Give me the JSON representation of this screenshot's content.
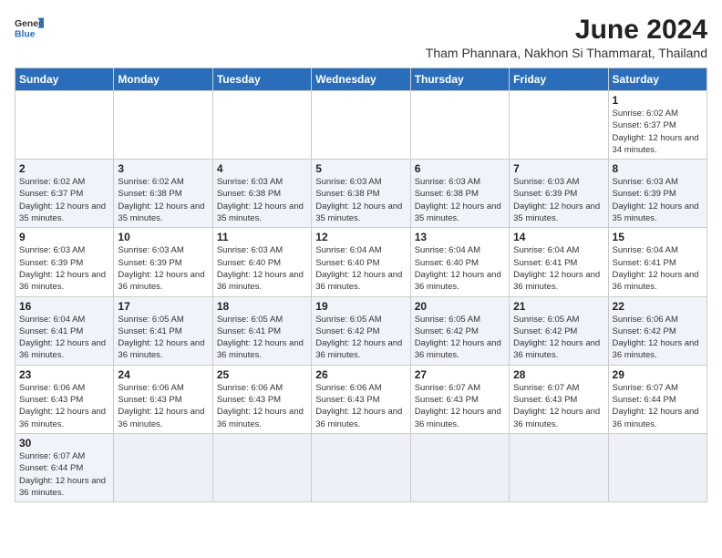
{
  "logo": {
    "text_general": "General",
    "text_blue": "Blue"
  },
  "title": "June 2024",
  "subtitle": "Tham Phannara, Nakhon Si Thammarat, Thailand",
  "days_of_week": [
    "Sunday",
    "Monday",
    "Tuesday",
    "Wednesday",
    "Thursday",
    "Friday",
    "Saturday"
  ],
  "weeks": [
    [
      {
        "day": "",
        "info": ""
      },
      {
        "day": "",
        "info": ""
      },
      {
        "day": "",
        "info": ""
      },
      {
        "day": "",
        "info": ""
      },
      {
        "day": "",
        "info": ""
      },
      {
        "day": "",
        "info": ""
      },
      {
        "day": "1",
        "info": "Sunrise: 6:02 AM\nSunset: 6:37 PM\nDaylight: 12 hours and 34 minutes."
      }
    ],
    [
      {
        "day": "2",
        "info": "Sunrise: 6:02 AM\nSunset: 6:37 PM\nDaylight: 12 hours and 35 minutes."
      },
      {
        "day": "3",
        "info": "Sunrise: 6:02 AM\nSunset: 6:38 PM\nDaylight: 12 hours and 35 minutes."
      },
      {
        "day": "4",
        "info": "Sunrise: 6:03 AM\nSunset: 6:38 PM\nDaylight: 12 hours and 35 minutes."
      },
      {
        "day": "5",
        "info": "Sunrise: 6:03 AM\nSunset: 6:38 PM\nDaylight: 12 hours and 35 minutes."
      },
      {
        "day": "6",
        "info": "Sunrise: 6:03 AM\nSunset: 6:38 PM\nDaylight: 12 hours and 35 minutes."
      },
      {
        "day": "7",
        "info": "Sunrise: 6:03 AM\nSunset: 6:39 PM\nDaylight: 12 hours and 35 minutes."
      },
      {
        "day": "8",
        "info": "Sunrise: 6:03 AM\nSunset: 6:39 PM\nDaylight: 12 hours and 35 minutes."
      }
    ],
    [
      {
        "day": "9",
        "info": "Sunrise: 6:03 AM\nSunset: 6:39 PM\nDaylight: 12 hours and 36 minutes."
      },
      {
        "day": "10",
        "info": "Sunrise: 6:03 AM\nSunset: 6:39 PM\nDaylight: 12 hours and 36 minutes."
      },
      {
        "day": "11",
        "info": "Sunrise: 6:03 AM\nSunset: 6:40 PM\nDaylight: 12 hours and 36 minutes."
      },
      {
        "day": "12",
        "info": "Sunrise: 6:04 AM\nSunset: 6:40 PM\nDaylight: 12 hours and 36 minutes."
      },
      {
        "day": "13",
        "info": "Sunrise: 6:04 AM\nSunset: 6:40 PM\nDaylight: 12 hours and 36 minutes."
      },
      {
        "day": "14",
        "info": "Sunrise: 6:04 AM\nSunset: 6:41 PM\nDaylight: 12 hours and 36 minutes."
      },
      {
        "day": "15",
        "info": "Sunrise: 6:04 AM\nSunset: 6:41 PM\nDaylight: 12 hours and 36 minutes."
      }
    ],
    [
      {
        "day": "16",
        "info": "Sunrise: 6:04 AM\nSunset: 6:41 PM\nDaylight: 12 hours and 36 minutes."
      },
      {
        "day": "17",
        "info": "Sunrise: 6:05 AM\nSunset: 6:41 PM\nDaylight: 12 hours and 36 minutes."
      },
      {
        "day": "18",
        "info": "Sunrise: 6:05 AM\nSunset: 6:41 PM\nDaylight: 12 hours and 36 minutes."
      },
      {
        "day": "19",
        "info": "Sunrise: 6:05 AM\nSunset: 6:42 PM\nDaylight: 12 hours and 36 minutes."
      },
      {
        "day": "20",
        "info": "Sunrise: 6:05 AM\nSunset: 6:42 PM\nDaylight: 12 hours and 36 minutes."
      },
      {
        "day": "21",
        "info": "Sunrise: 6:05 AM\nSunset: 6:42 PM\nDaylight: 12 hours and 36 minutes."
      },
      {
        "day": "22",
        "info": "Sunrise: 6:06 AM\nSunset: 6:42 PM\nDaylight: 12 hours and 36 minutes."
      }
    ],
    [
      {
        "day": "23",
        "info": "Sunrise: 6:06 AM\nSunset: 6:43 PM\nDaylight: 12 hours and 36 minutes."
      },
      {
        "day": "24",
        "info": "Sunrise: 6:06 AM\nSunset: 6:43 PM\nDaylight: 12 hours and 36 minutes."
      },
      {
        "day": "25",
        "info": "Sunrise: 6:06 AM\nSunset: 6:43 PM\nDaylight: 12 hours and 36 minutes."
      },
      {
        "day": "26",
        "info": "Sunrise: 6:06 AM\nSunset: 6:43 PM\nDaylight: 12 hours and 36 minutes."
      },
      {
        "day": "27",
        "info": "Sunrise: 6:07 AM\nSunset: 6:43 PM\nDaylight: 12 hours and 36 minutes."
      },
      {
        "day": "28",
        "info": "Sunrise: 6:07 AM\nSunset: 6:43 PM\nDaylight: 12 hours and 36 minutes."
      },
      {
        "day": "29",
        "info": "Sunrise: 6:07 AM\nSunset: 6:44 PM\nDaylight: 12 hours and 36 minutes."
      }
    ],
    [
      {
        "day": "30",
        "info": "Sunrise: 6:07 AM\nSunset: 6:44 PM\nDaylight: 12 hours and 36 minutes."
      },
      {
        "day": "",
        "info": ""
      },
      {
        "day": "",
        "info": ""
      },
      {
        "day": "",
        "info": ""
      },
      {
        "day": "",
        "info": ""
      },
      {
        "day": "",
        "info": ""
      },
      {
        "day": "",
        "info": ""
      }
    ]
  ],
  "accent_color": "#2A6EBB"
}
